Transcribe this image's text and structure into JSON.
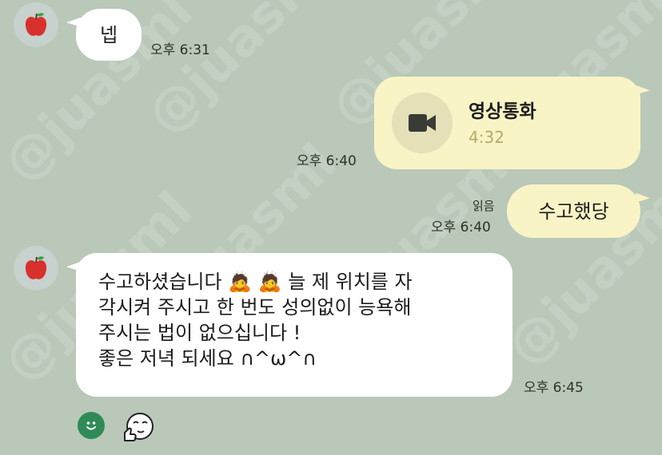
{
  "watermark": "@juasml",
  "messages": [
    {
      "sender": "them",
      "text": "넵",
      "time": "오후 6:31"
    },
    {
      "sender": "me",
      "type": "video-call",
      "title": "영상통화",
      "duration": "4:32",
      "time": "오후 6:40"
    },
    {
      "sender": "me",
      "text": "수고했당",
      "read": "읽음",
      "time": "오후 6:40"
    },
    {
      "sender": "them",
      "lines": [
        "수고하셨습니다 🙇 🙇  늘 제 위치를 자",
        "각시켜 주시고 한 번도 성의없이 능욕해",
        "주시는 법이 없으십니다 !",
        "좋은 저녁 되세요 ∩^ω^∩"
      ],
      "time": "오후 6:45"
    }
  ],
  "colors": {
    "background": "#b9c8b8",
    "incoming": "#ffffff",
    "outgoing": "#f9f4c6",
    "duration": "#b8a868",
    "reaction": "#2e8b57"
  },
  "icons": {
    "avatar": "apple-icon",
    "video": "video-camera-icon",
    "reaction_1": "smile-icon",
    "reaction_2": "thumbs-up-face-icon"
  }
}
